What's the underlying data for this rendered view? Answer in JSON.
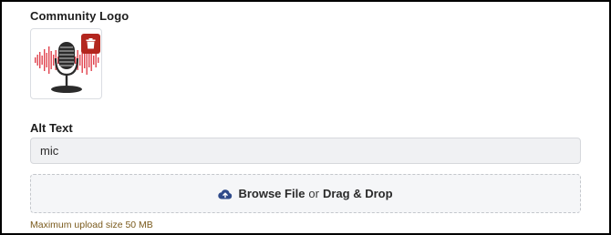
{
  "logo_section": {
    "label": "Community Logo"
  },
  "alt_text": {
    "label": "Alt Text",
    "value": "mic"
  },
  "upload": {
    "browse_label": "Browse File",
    "or_label": "or",
    "drag_label": "Drag & Drop",
    "hint": "Maximum upload size 50 MB"
  },
  "icons": {
    "delete": "trash-icon",
    "upload": "cloud-upload-icon"
  },
  "colors": {
    "delete_button": "#b3261e",
    "upload_icon": "#2f4a8a",
    "hint_text": "#7a5a1c",
    "soundwave": "#e0434e"
  }
}
